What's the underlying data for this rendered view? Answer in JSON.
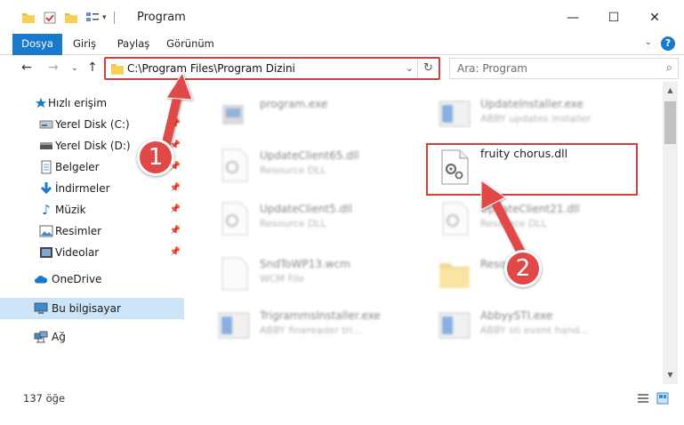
{
  "window": {
    "title": "Program",
    "minimize": "—",
    "maximize": "☐",
    "close": "✕"
  },
  "ribbon": {
    "tabs": [
      {
        "label": "Dosya",
        "active": true
      },
      {
        "label": "Giriş"
      },
      {
        "label": "Paylaş"
      },
      {
        "label": "Görünüm"
      }
    ],
    "help": "?"
  },
  "address": {
    "path": "C:\\Program Files\\Program Dizini",
    "search_placeholder": "Ara: Program"
  },
  "nav": {
    "items": [
      {
        "label": "Hızlı erişim",
        "icon": "star-icon"
      },
      {
        "label": "Yerel Disk (C:)",
        "icon": "drive-icon",
        "pinned": true
      },
      {
        "label": "Yerel Disk (D:)",
        "icon": "drive-icon",
        "pinned": true
      },
      {
        "label": "Belgeler",
        "icon": "documents-icon",
        "pinned": true
      },
      {
        "label": "İndirmeler",
        "icon": "download-icon",
        "pinned": true
      },
      {
        "label": "Müzik",
        "icon": "music-icon",
        "pinned": true
      },
      {
        "label": "Resimler",
        "icon": "pictures-icon",
        "pinned": true
      },
      {
        "label": "Videolar",
        "icon": "videos-icon",
        "pinned": true
      },
      {
        "label": "OneDrive",
        "icon": "onedrive-icon"
      },
      {
        "label": "Bu bilgisayar",
        "icon": "computer-icon",
        "selected": true
      },
      {
        "label": "Ağ",
        "icon": "network-icon"
      }
    ]
  },
  "files": [
    {
      "name": "program.exe",
      "type": "",
      "icon": "exe-icon"
    },
    {
      "name": "UpdateInstaller.exe",
      "type": "ABBY updates installer",
      "icon": "installer-icon"
    },
    {
      "name": "UpdateClient65.dll",
      "type": "Resource DLL",
      "icon": "dll-icon"
    },
    {
      "name": "fruity chorus.dll",
      "type": "",
      "icon": "dll-icon",
      "highlighted": true
    },
    {
      "name": "UpdateClient5.dll",
      "type": "Resource DLL",
      "icon": "dll-icon"
    },
    {
      "name": "UpdateClient21.dll",
      "type": "Resource DLL",
      "icon": "dll-icon"
    },
    {
      "name": "SndToWP13.wcm",
      "type": "WCM File",
      "icon": "file-icon"
    },
    {
      "name": "Resources",
      "type": "",
      "icon": "folder-icon"
    },
    {
      "name": "TrigrammsInstaller.exe",
      "type": "ABBY finereader tri...",
      "icon": "installer-icon"
    },
    {
      "name": "AbbyySTI.exe",
      "type": "ABBY sti event hand...",
      "icon": "installer-icon"
    }
  ],
  "status": {
    "count": "137 öğe"
  },
  "annotations": {
    "step1": "1",
    "step2": "2"
  },
  "colors": {
    "accent": "#1979ca",
    "highlight": "#d33e3e",
    "selected": "#cce4f7"
  }
}
